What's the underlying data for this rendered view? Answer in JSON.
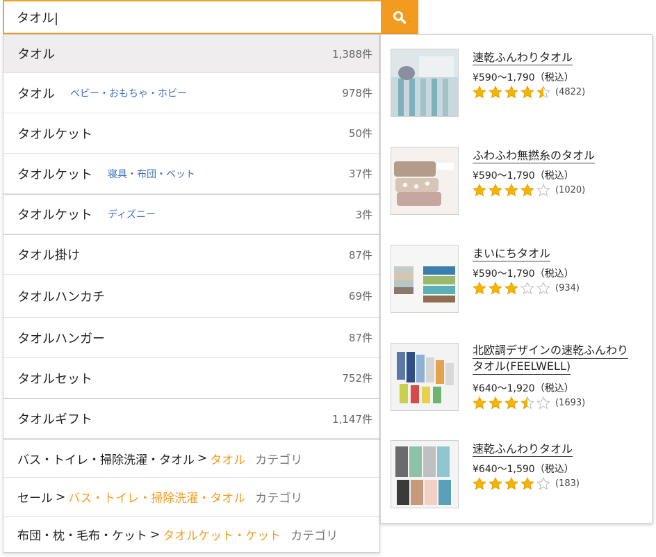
{
  "search": {
    "value": "タオル|"
  },
  "colors": {
    "accent": "#f29b1e",
    "link_blue": "#3e6fc2",
    "star": "#f5b400"
  },
  "suggestions": [
    {
      "term": "タオル",
      "category": "",
      "count": "1,388件"
    },
    {
      "term": "タオル",
      "category": "ベビー・おもちゃ・ホビー",
      "count": "978件"
    },
    {
      "term": "タオルケット",
      "category": "",
      "count": "50件"
    },
    {
      "term": "タオルケット",
      "category": "寝具・布団・ベット",
      "count": "37件"
    },
    {
      "term": "タオルケット",
      "category": "ディズニー",
      "count": "3件"
    },
    {
      "term": "タオル掛け",
      "category": "",
      "count": "87件"
    },
    {
      "term": "タオルハンカチ",
      "category": "",
      "count": "69件"
    },
    {
      "term": "タオルハンガー",
      "category": "",
      "count": "87件"
    },
    {
      "term": "タオルセット",
      "category": "",
      "count": "752件"
    },
    {
      "term": "タオルギフト",
      "category": "",
      "count": "1,147件"
    }
  ],
  "categories": [
    {
      "path": "バス・トイレ・掃除洗濯・タオル",
      "target": "タオル",
      "tag": "カテゴリ"
    },
    {
      "path": "セール",
      "target": "バス・トイレ・掃除洗濯・タオル",
      "tag": "カテゴリ"
    },
    {
      "path": "布団・枕・毛布・ケット",
      "target": "タオルケット・ケット",
      "tag": "カテゴリ"
    }
  ],
  "products": [
    {
      "name": "速乾ふんわりタオル",
      "price": "¥590〜1,790（税込）",
      "rating": 4.5,
      "reviews": "(4822)"
    },
    {
      "name": "ふわふわ無撚糸のタオル",
      "price": "¥590〜1,790（税込）",
      "rating": 4,
      "reviews": "(1020)"
    },
    {
      "name": "まいにちタオル",
      "price": "¥590〜1,790（税込）",
      "rating": 3,
      "reviews": "(934)"
    },
    {
      "name_line1": "北欧調デザインの速乾ふんわり",
      "name_line2": "タオル(FEELWELL)",
      "price": "¥640〜1,920（税込）",
      "rating": 3.5,
      "reviews": "(1693)"
    },
    {
      "name": "速乾ふんわりタオル",
      "price": "¥640〜1,590（税込）",
      "rating": 4,
      "reviews": "(183)"
    }
  ]
}
